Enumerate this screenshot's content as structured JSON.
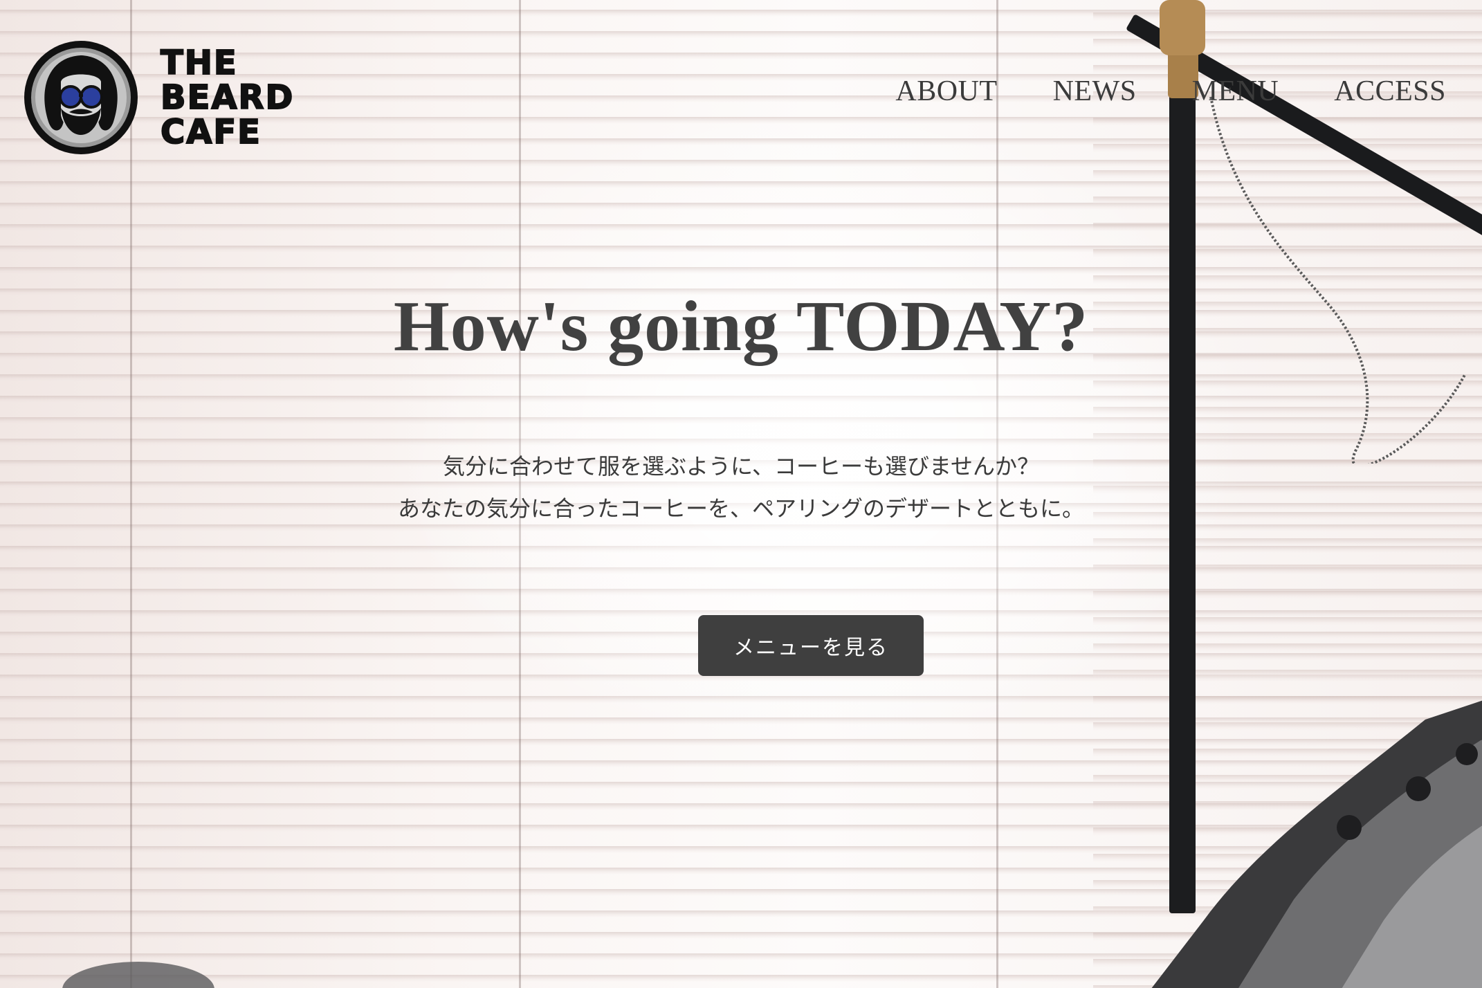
{
  "brand": {
    "name_lines": [
      "THE",
      "BEARD",
      "CAFE"
    ],
    "logo_icon": "bearded-man-sunglasses-icon"
  },
  "nav": {
    "items": [
      {
        "label": "ABOUT"
      },
      {
        "label": "NEWS"
      },
      {
        "label": "MENU"
      },
      {
        "label": "ACCESS"
      }
    ]
  },
  "hero": {
    "title": "How's going TODAY?",
    "copy_line1": "気分に合わせて服を選ぶように、コーヒーも選びませんか？",
    "copy_line2": "あなたの気分に合ったコーヒーを、ペアリングのデザートとともに。",
    "cta_label": "メニューを見る"
  },
  "colors": {
    "text": "#414141",
    "button_bg": "#3f3f3f",
    "button_text": "#ffffff",
    "lens_blue": "#2b3f9e"
  }
}
